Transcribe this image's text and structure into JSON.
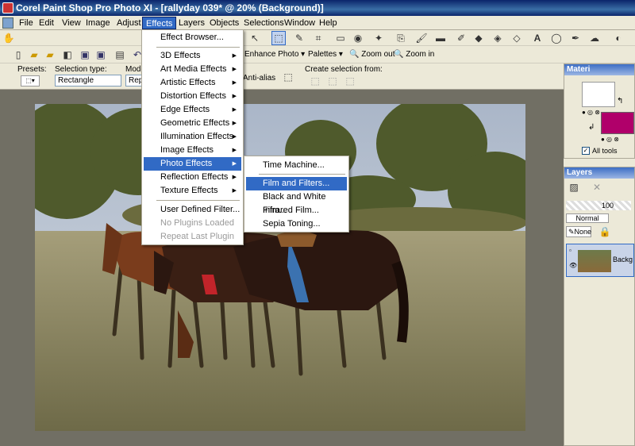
{
  "title": "Corel Paint Shop Pro Photo XI - [rallyday 039* @  20% (Background)]",
  "menubar": [
    "File",
    "Edit",
    "View",
    "Image",
    "Adjust",
    "Effects",
    "Layers",
    "Objects",
    "Selections",
    "Window",
    "Help"
  ],
  "toolbar2": {
    "enhance_photo": "Enhance Photo",
    "palettes": "Palettes",
    "zoom_out": "Zoom out",
    "zoom_in": "Zoom in"
  },
  "tool_options": {
    "presets_label": "Presets:",
    "selection_type_label": "Selection type:",
    "selection_type_value": "Rectangle",
    "mode_label": "Mode",
    "mode_value": "Repl",
    "antialias": "Anti-alias",
    "create_selection_label": "Create selection from:"
  },
  "effects_menu": [
    {
      "label": "Effect Browser...",
      "arrow": false,
      "disabled": false
    },
    {
      "label": "3D Effects",
      "arrow": true,
      "disabled": false
    },
    {
      "label": "Art Media Effects",
      "arrow": true,
      "disabled": false
    },
    {
      "label": "Artistic Effects",
      "arrow": true,
      "disabled": false
    },
    {
      "label": "Distortion Effects",
      "arrow": true,
      "disabled": false
    },
    {
      "label": "Edge Effects",
      "arrow": true,
      "disabled": false
    },
    {
      "label": "Geometric Effects",
      "arrow": true,
      "disabled": false
    },
    {
      "label": "Illumination Effects",
      "arrow": true,
      "disabled": false
    },
    {
      "label": "Image Effects",
      "arrow": true,
      "disabled": false
    },
    {
      "label": "Photo Effects",
      "arrow": true,
      "disabled": false,
      "highlighted": true
    },
    {
      "label": "Reflection Effects",
      "arrow": true,
      "disabled": false
    },
    {
      "label": "Texture Effects",
      "arrow": true,
      "disabled": false
    },
    {
      "label": "User Defined Filter...",
      "arrow": false,
      "disabled": false
    },
    {
      "label": "No Plugins Loaded",
      "arrow": false,
      "disabled": true
    },
    {
      "label": "Repeat Last Plugin",
      "arrow": false,
      "disabled": true
    }
  ],
  "photo_effects_submenu": [
    {
      "label": "Time Machine...",
      "highlighted": false
    },
    {
      "label": "Film and Filters...",
      "highlighted": true
    },
    {
      "label": "Black and White Film...",
      "highlighted": false
    },
    {
      "label": "Infrared Film...",
      "highlighted": false
    },
    {
      "label": "Sepia Toning...",
      "highlighted": false
    }
  ],
  "materials": {
    "title": "Materi",
    "all_tools": "All tools",
    "fg_color": "#ffffff",
    "bg_color": "#b0006a"
  },
  "layers": {
    "title": "Layers",
    "opacity": "100",
    "blend": "Normal",
    "mask": "None",
    "layer_name": "Backg"
  },
  "colors": {
    "accent": "#316ac5",
    "menu_bg": "#ece9d8",
    "workspace": "#716f64"
  }
}
